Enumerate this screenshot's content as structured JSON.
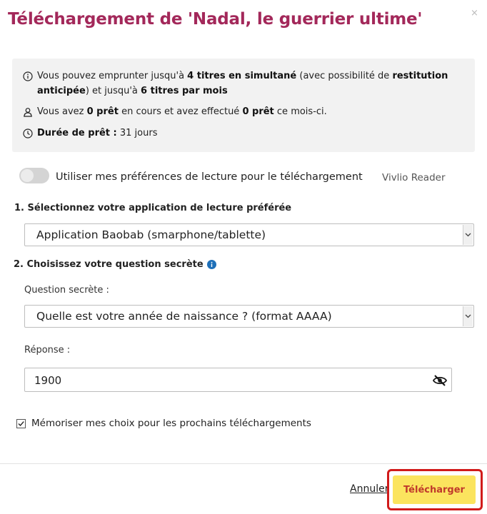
{
  "dialog": {
    "title": "Téléchargement de 'Nadal, le guerrier ultime'",
    "close_icon": "×"
  },
  "info": {
    "line1": {
      "p1": "Vous pouvez emprunter jusqu'à ",
      "b1": "4 titres en simultané",
      "p2": " (avec possibilité de ",
      "b2": "restitution anticipée",
      "p3": ") et jusqu'à ",
      "b3": "6 titres par mois"
    },
    "line2": {
      "p1": "Vous avez ",
      "b1": "0 prêt",
      "p2": " en cours et avez effectué ",
      "b2": "0 prêt",
      "p3": " ce mois-ci."
    },
    "line3": {
      "b1": "Durée de prêt :",
      "p1": " 31 jours"
    }
  },
  "preferences": {
    "toggle_label": "Utiliser mes préférences de lecture pour le téléchargement",
    "toggle_on": false,
    "reader_label": "Vivlio Reader"
  },
  "step1": {
    "label": "1. Sélectionnez votre application de lecture préférée",
    "selected": "Application Baobab (smarphone/tablette)"
  },
  "step2": {
    "label": "2. Choisissez votre question secrète",
    "question_label": "Question secrète :",
    "question_selected": "Quelle est votre année de naissance ? (format AAAA)",
    "answer_label": "Réponse :",
    "answer_value": "1900"
  },
  "remember": {
    "label": "Mémoriser mes choix pour les prochains téléchargements",
    "checked": true
  },
  "footer": {
    "cancel_label": "Annuler",
    "download_label": "Télécharger"
  },
  "colors": {
    "title": "#a3285a",
    "download_button_bg": "#fbe45e",
    "download_button_text": "#c0392b",
    "highlight_border": "#d11a1a",
    "info_icon": "#1e6fb8"
  }
}
